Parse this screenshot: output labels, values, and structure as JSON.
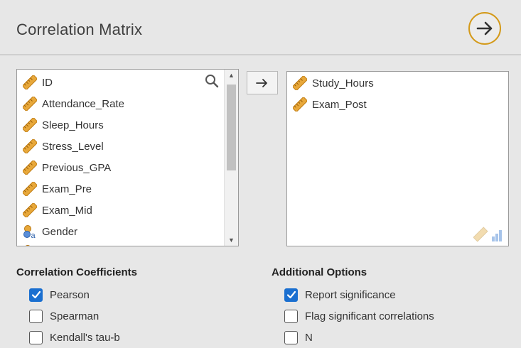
{
  "header": {
    "title": "Correlation Matrix"
  },
  "source_list": {
    "items": [
      {
        "label": "ID",
        "type": "continuous"
      },
      {
        "label": "Attendance_Rate",
        "type": "continuous"
      },
      {
        "label": "Sleep_Hours",
        "type": "continuous"
      },
      {
        "label": "Stress_Level",
        "type": "continuous"
      },
      {
        "label": "Previous_GPA",
        "type": "continuous"
      },
      {
        "label": "Exam_Pre",
        "type": "continuous"
      },
      {
        "label": "Exam_Mid",
        "type": "continuous"
      },
      {
        "label": "Gender",
        "type": "nominal"
      }
    ]
  },
  "target_list": {
    "items": [
      {
        "label": "Study_Hours",
        "type": "continuous"
      },
      {
        "label": "Exam_Post",
        "type": "continuous"
      }
    ]
  },
  "coefficients": {
    "title": "Correlation Coefficients",
    "pearson": {
      "label": "Pearson",
      "checked": true
    },
    "spearman": {
      "label": "Spearman",
      "checked": false
    },
    "kendall": {
      "label": "Kendall's tau-b",
      "checked": false
    }
  },
  "additional": {
    "title": "Additional Options",
    "report_sig": {
      "label": "Report significance",
      "checked": true
    },
    "flag_sig": {
      "label": "Flag significant correlations",
      "checked": false
    },
    "n": {
      "label": "N",
      "checked": false
    }
  },
  "colors": {
    "accent": "#d49a1a",
    "checkbox": "#1a6fd0",
    "ruler": "#e8a83a"
  }
}
